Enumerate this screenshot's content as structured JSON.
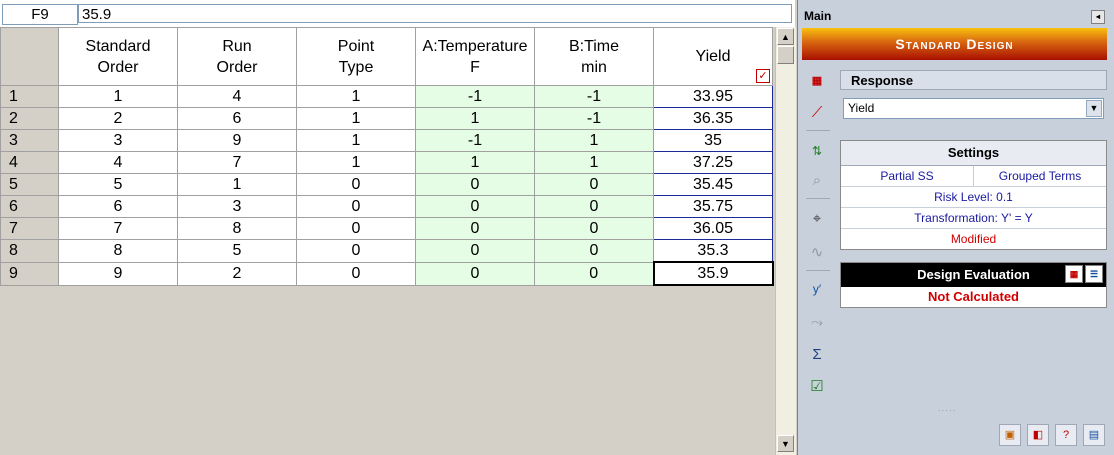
{
  "formula_bar": {
    "cell_ref": "F9",
    "value": "35.9"
  },
  "grid": {
    "headers": [
      {
        "line1": "Standard",
        "line2": "Order"
      },
      {
        "line1": "Run",
        "line2": "Order"
      },
      {
        "line1": "Point",
        "line2": "Type"
      },
      {
        "line1": "A:Temperature",
        "line2": "F"
      },
      {
        "line1": "B:Time",
        "line2": "min"
      },
      {
        "line1": "Yield",
        "line2": ""
      }
    ],
    "rows": [
      {
        "n": "1",
        "std": "1",
        "run": "4",
        "pt": "1",
        "a": "-1",
        "b": "-1",
        "y": "33.95"
      },
      {
        "n": "2",
        "std": "2",
        "run": "6",
        "pt": "1",
        "a": "1",
        "b": "-1",
        "y": "36.35"
      },
      {
        "n": "3",
        "std": "3",
        "run": "9",
        "pt": "1",
        "a": "-1",
        "b": "1",
        "y": "35"
      },
      {
        "n": "4",
        "std": "4",
        "run": "7",
        "pt": "1",
        "a": "1",
        "b": "1",
        "y": "37.25"
      },
      {
        "n": "5",
        "std": "5",
        "run": "1",
        "pt": "0",
        "a": "0",
        "b": "0",
        "y": "35.45"
      },
      {
        "n": "6",
        "std": "6",
        "run": "3",
        "pt": "0",
        "a": "0",
        "b": "0",
        "y": "35.75"
      },
      {
        "n": "7",
        "std": "7",
        "run": "8",
        "pt": "0",
        "a": "0",
        "b": "0",
        "y": "36.05"
      },
      {
        "n": "8",
        "std": "8",
        "run": "5",
        "pt": "0",
        "a": "0",
        "b": "0",
        "y": "35.3"
      },
      {
        "n": "9",
        "std": "9",
        "run": "2",
        "pt": "0",
        "a": "0",
        "b": "0",
        "y": "35.9"
      }
    ]
  },
  "panel": {
    "title": "Main",
    "banner": "Standard Design",
    "response": {
      "title": "Response",
      "selected": "Yield"
    },
    "settings": {
      "title": "Settings",
      "partial_ss": "Partial SS",
      "grouped_terms": "Grouped Terms",
      "risk_level": "Risk Level: 0.1",
      "transformation": "Transformation: Y' = Y",
      "status": "Modified"
    },
    "design_evaluation": {
      "title": "Design Evaluation",
      "status": "Not Calculated"
    }
  },
  "icons": {
    "toolstrip": [
      "table-icon",
      "scatter-plot-icon",
      "sort-icon",
      "zoom-plot-icon",
      "target-icon",
      "curve-icon",
      "transform-icon",
      "trend-icon",
      "sigma-icon",
      "checklist-icon"
    ],
    "bottom": [
      "export-icon",
      "report-icon",
      "help-icon",
      "window-icon"
    ]
  },
  "colors": {
    "factor_fill": "#e5fde4",
    "banner_top": "#f8c010",
    "banner_bottom": "#a81000",
    "status_red": "#d00000"
  }
}
